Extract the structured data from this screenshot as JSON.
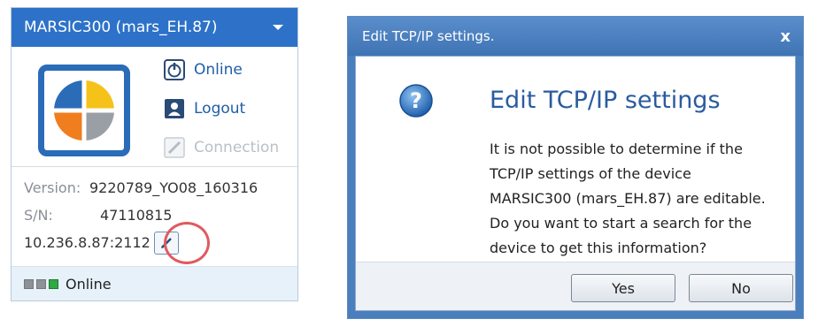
{
  "device_panel": {
    "title": "MARSIC300 (mars_EH.87)",
    "actions": {
      "online": "Online",
      "logout": "Logout",
      "connection": "Connection"
    },
    "version_label": "Version:",
    "version_value": "9220789_YO08_160316",
    "sn_label": "S/N:",
    "sn_value": "47110815",
    "address": "10.236.8.87:2112",
    "status": "Online"
  },
  "dialog": {
    "window_title": "Edit TCP/IP settings.",
    "close_label": "x",
    "heading": "Edit TCP/IP settings",
    "message_lines": [
      "It is not possible to determine if the",
      "TCP/IP settings of the device",
      "MARSIC300 (mars_EH.87) are editable.",
      "Do you want to start a search for the",
      "device to get this information?"
    ],
    "yes_label": "Yes",
    "no_label": "No"
  },
  "colors": {
    "header_blue": "#2d72c8",
    "highlight_ring": "#e05a5f",
    "status_led_on": "#2fa845"
  },
  "icons": [
    "caret-down-icon",
    "device-logo",
    "power-icon",
    "user-icon",
    "connection-icon",
    "pencil-icon",
    "question-icon",
    "close-icon"
  ]
}
